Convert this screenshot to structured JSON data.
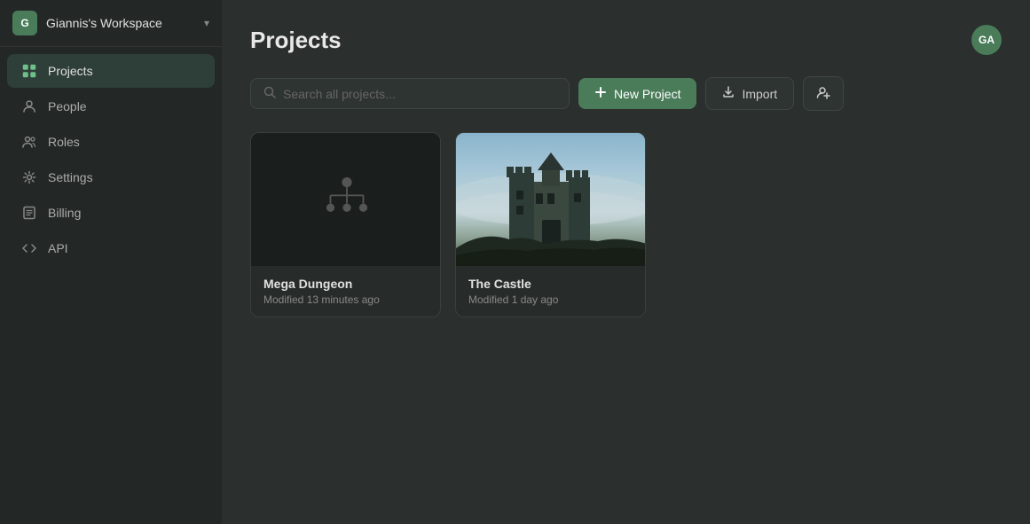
{
  "workspace": {
    "initial": "G",
    "name": "Giannis's Workspace",
    "chevron": "▾"
  },
  "nav": {
    "items": [
      {
        "id": "projects",
        "label": "Projects",
        "active": true,
        "icon": "grid"
      },
      {
        "id": "people",
        "label": "People",
        "active": false,
        "icon": "person"
      },
      {
        "id": "roles",
        "label": "Roles",
        "active": false,
        "icon": "users"
      },
      {
        "id": "settings",
        "label": "Settings",
        "active": false,
        "icon": "gear"
      },
      {
        "id": "billing",
        "label": "Billing",
        "active": false,
        "icon": "receipt"
      },
      {
        "id": "api",
        "label": "API",
        "active": false,
        "icon": "code"
      }
    ]
  },
  "main": {
    "title": "Projects",
    "search_placeholder": "Search all projects...",
    "new_project_label": "New Project",
    "import_label": "Import"
  },
  "user": {
    "initials": "GA"
  },
  "projects": [
    {
      "id": "mega-dungeon",
      "name": "Mega Dungeon",
      "meta": "Modified 13 minutes ago",
      "thumbnail_type": "icon"
    },
    {
      "id": "the-castle",
      "name": "The Castle",
      "meta": "Modified 1 day ago",
      "thumbnail_type": "image"
    }
  ]
}
